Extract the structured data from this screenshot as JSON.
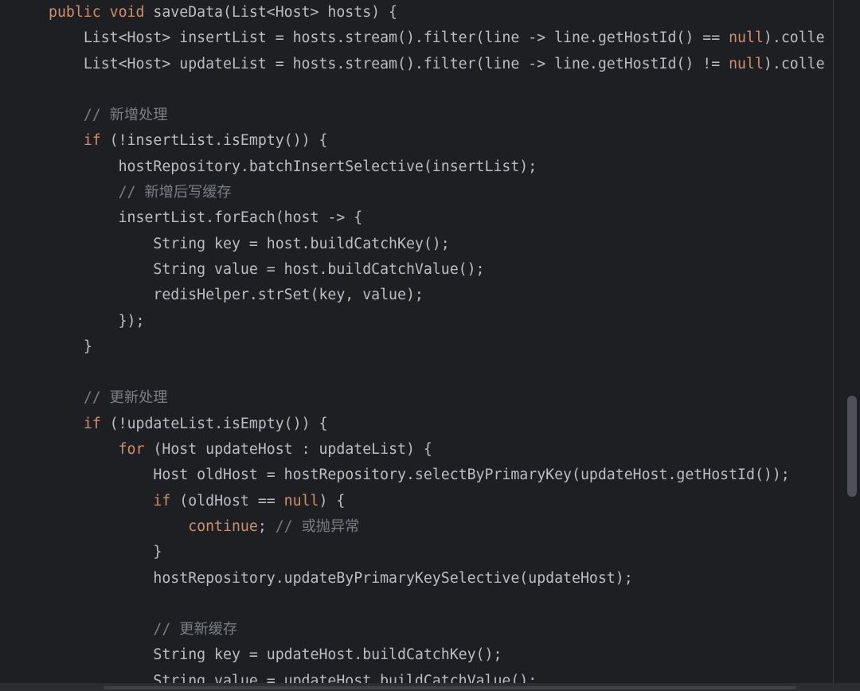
{
  "editor": {
    "lines": [
      {
        "indent": "",
        "tokens": [
          {
            "k": "kw",
            "t": "public void "
          },
          {
            "k": "txt",
            "t": "saveData(List<Host> hosts) {"
          }
        ]
      },
      {
        "indent": "    ",
        "tokens": [
          {
            "k": "txt",
            "t": "List<Host> insertList = hosts.stream().filter(line -> line.getHostId() == "
          },
          {
            "k": "kw",
            "t": "null"
          },
          {
            "k": "txt",
            "t": ").colle"
          }
        ]
      },
      {
        "indent": "    ",
        "tokens": [
          {
            "k": "txt",
            "t": "List<Host> updateList = hosts.stream().filter(line -> line.getHostId() != "
          },
          {
            "k": "kw",
            "t": "null"
          },
          {
            "k": "txt",
            "t": ").colle"
          }
        ]
      },
      {
        "indent": "",
        "tokens": []
      },
      {
        "indent": "    ",
        "tokens": [
          {
            "k": "cm",
            "t": "// 新增处理"
          }
        ]
      },
      {
        "indent": "    ",
        "tokens": [
          {
            "k": "kw",
            "t": "if "
          },
          {
            "k": "txt",
            "t": "(!insertList.isEmpty()) {"
          }
        ]
      },
      {
        "indent": "        ",
        "tokens": [
          {
            "k": "txt",
            "t": "hostRepository.batchInsertSelective(insertList);"
          }
        ]
      },
      {
        "indent": "        ",
        "tokens": [
          {
            "k": "cm",
            "t": "// 新增后写缓存"
          }
        ]
      },
      {
        "indent": "        ",
        "tokens": [
          {
            "k": "txt",
            "t": "insertList.forEach(host -> {"
          }
        ]
      },
      {
        "indent": "            ",
        "tokens": [
          {
            "k": "txt",
            "t": "String key = host.buildCatchKey();"
          }
        ]
      },
      {
        "indent": "            ",
        "tokens": [
          {
            "k": "txt",
            "t": "String value = host.buildCatchValue();"
          }
        ]
      },
      {
        "indent": "            ",
        "tokens": [
          {
            "k": "txt",
            "t": "redisHelper.strSet(key, value);"
          }
        ]
      },
      {
        "indent": "        ",
        "tokens": [
          {
            "k": "txt",
            "t": "});"
          }
        ]
      },
      {
        "indent": "    ",
        "tokens": [
          {
            "k": "txt",
            "t": "}"
          }
        ]
      },
      {
        "indent": "",
        "tokens": []
      },
      {
        "indent": "    ",
        "tokens": [
          {
            "k": "cm",
            "t": "// 更新处理"
          }
        ]
      },
      {
        "indent": "    ",
        "tokens": [
          {
            "k": "kw",
            "t": "if "
          },
          {
            "k": "txt",
            "t": "(!updateList.isEmpty()) {"
          }
        ]
      },
      {
        "indent": "        ",
        "tokens": [
          {
            "k": "kw",
            "t": "for "
          },
          {
            "k": "txt",
            "t": "(Host updateHost : updateList) {"
          }
        ]
      },
      {
        "indent": "            ",
        "tokens": [
          {
            "k": "txt",
            "t": "Host oldHost = hostRepository.selectByPrimaryKey(updateHost.getHostId());"
          }
        ]
      },
      {
        "indent": "            ",
        "tokens": [
          {
            "k": "kw",
            "t": "if "
          },
          {
            "k": "txt",
            "t": "(oldHost == "
          },
          {
            "k": "kw",
            "t": "null"
          },
          {
            "k": "txt",
            "t": ") {"
          }
        ]
      },
      {
        "indent": "                ",
        "tokens": [
          {
            "k": "kw",
            "t": "continue"
          },
          {
            "k": "txt",
            "t": "; "
          },
          {
            "k": "cm",
            "t": "// 或抛异常"
          }
        ]
      },
      {
        "indent": "            ",
        "tokens": [
          {
            "k": "txt",
            "t": "}"
          }
        ]
      },
      {
        "indent": "            ",
        "tokens": [
          {
            "k": "txt",
            "t": "hostRepository.updateByPrimaryKeySelective(updateHost);"
          }
        ]
      },
      {
        "indent": "",
        "tokens": []
      },
      {
        "indent": "            ",
        "tokens": [
          {
            "k": "cm",
            "t": "// 更新缓存"
          }
        ]
      },
      {
        "indent": "            ",
        "tokens": [
          {
            "k": "txt",
            "t": "String key = updateHost.buildCatchKey();"
          }
        ]
      },
      {
        "indent": "            ",
        "tokens": [
          {
            "k": "txt",
            "t": "String value = updateHost.buildCatchValue();"
          }
        ]
      }
    ]
  },
  "colors": {
    "background": "#1e1f22",
    "keyword": "#cf8e6d",
    "comment": "#7a7e85",
    "text": "#bcbec4"
  }
}
